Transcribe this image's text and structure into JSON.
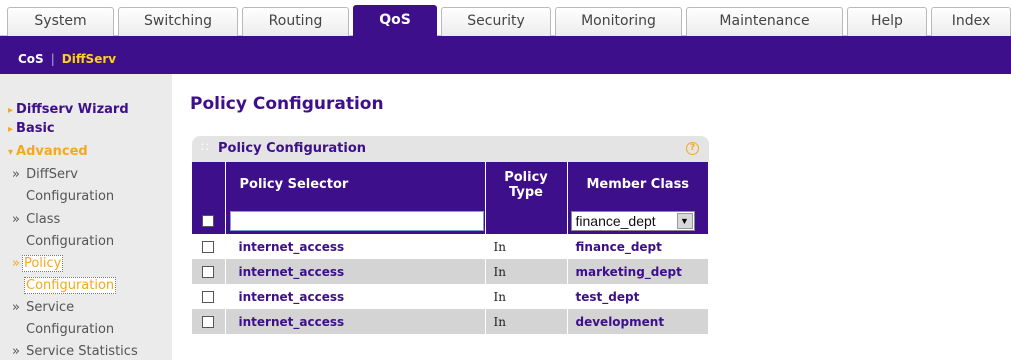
{
  "tabs": [
    {
      "label": "System",
      "active": false
    },
    {
      "label": "Switching",
      "active": false
    },
    {
      "label": "Routing",
      "active": false
    },
    {
      "label": "QoS",
      "active": true
    },
    {
      "label": "Security",
      "active": false
    },
    {
      "label": "Monitoring",
      "active": false
    },
    {
      "label": "Maintenance",
      "active": false
    },
    {
      "label": "Help",
      "active": false
    },
    {
      "label": "Index",
      "active": false
    }
  ],
  "subnav": {
    "cos": "CoS",
    "separator": "|",
    "diffserv": "DiffServ"
  },
  "sidebar": {
    "wizard": "Diffserv Wizard",
    "basic": "Basic",
    "advanced": "Advanced",
    "sub": [
      {
        "line1": "DiffServ",
        "line2": "Configuration"
      },
      {
        "line1": "Class",
        "line2": "Configuration"
      },
      {
        "line1": "Policy",
        "line2": "Configuration"
      },
      {
        "line1": "Service",
        "line2": "Configuration"
      },
      {
        "line1": "Service Statistics"
      }
    ]
  },
  "page": {
    "title": "Policy Configuration"
  },
  "panel": {
    "title": "Policy Configuration",
    "help": "?",
    "columns": {
      "selector": "Policy Selector",
      "type_line1": "Policy",
      "type_line2": "Type",
      "member": "Member Class"
    },
    "edit_row": {
      "selector_value": "",
      "member_select": "finance_dept"
    },
    "rows": [
      {
        "selector": "internet_access",
        "type": "In",
        "member": "finance_dept"
      },
      {
        "selector": "internet_access",
        "type": "In",
        "member": "marketing_dept"
      },
      {
        "selector": "internet_access",
        "type": "In",
        "member": "test_dept"
      },
      {
        "selector": "internet_access",
        "type": "In",
        "member": "development"
      }
    ]
  },
  "colors": {
    "brand": "#3d0f8a",
    "accent": "#f7a81a",
    "row_alt": "#d4d4d4"
  }
}
